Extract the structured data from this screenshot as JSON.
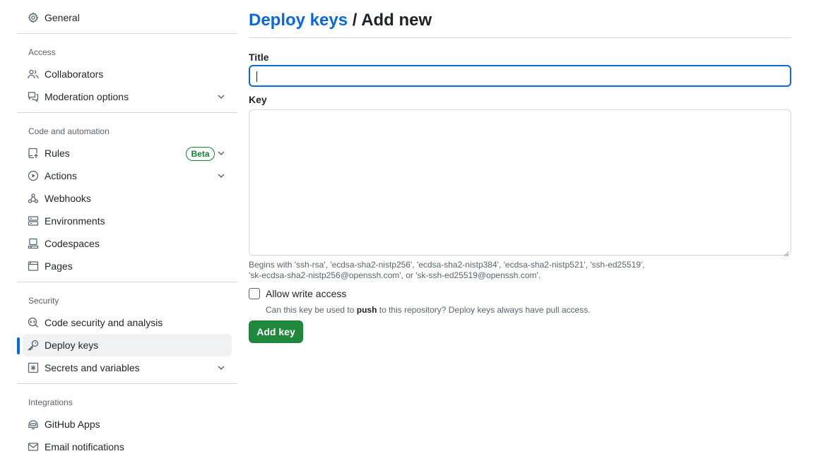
{
  "sidebar": {
    "general": {
      "label": "General",
      "icon": "gear-icon"
    },
    "sections": {
      "access": "Access",
      "code_automation": "Code and automation",
      "security": "Security",
      "integrations": "Integrations"
    },
    "items": {
      "collaborators": {
        "label": "Collaborators",
        "icon": "people-icon"
      },
      "moderation": {
        "label": "Moderation options",
        "icon": "comment-discussion-icon"
      },
      "rules": {
        "label": "Rules",
        "icon": "repo-push-icon",
        "badge": "Beta"
      },
      "actions": {
        "label": "Actions",
        "icon": "play-icon"
      },
      "webhooks": {
        "label": "Webhooks",
        "icon": "webhook-icon"
      },
      "environments": {
        "label": "Environments",
        "icon": "server-icon"
      },
      "codespaces": {
        "label": "Codespaces",
        "icon": "codespaces-icon"
      },
      "pages": {
        "label": "Pages",
        "icon": "browser-icon"
      },
      "code_security": {
        "label": "Code security and analysis",
        "icon": "codescan-icon"
      },
      "deploy_keys": {
        "label": "Deploy keys",
        "icon": "key-icon",
        "active": true
      },
      "secrets": {
        "label": "Secrets and variables",
        "icon": "key-asterisk-icon"
      },
      "github_apps": {
        "label": "GitHub Apps",
        "icon": "hubot-icon"
      },
      "email": {
        "label": "Email notifications",
        "icon": "mail-icon"
      }
    }
  },
  "main": {
    "breadcrumb": "Deploy keys",
    "title_suffix": " / Add new",
    "title_label": "Title",
    "title_value": "",
    "key_label": "Key",
    "key_value": "",
    "hint_line1": "Begins with 'ssh-rsa', 'ecdsa-sha2-nistp256', 'ecdsa-sha2-nistp384', 'ecdsa-sha2-nistp521', 'ssh-ed25519',",
    "hint_line2": "'sk-ecdsa-sha2-nistp256@openssh.com', or 'sk-ssh-ed25519@openssh.com'.",
    "allow_write_label": "Allow write access",
    "allow_write_checked": false,
    "note_pre": "Can this key be used to ",
    "note_bold": "push",
    "note_post": " to this repository? Deploy keys always have pull access.",
    "add_button": "Add key"
  },
  "colors": {
    "accent": "#0969da",
    "primary_button": "#1f883d",
    "beta_badge": "#1a7f37",
    "muted_text": "#59636e",
    "border": "#d1d9e0"
  }
}
